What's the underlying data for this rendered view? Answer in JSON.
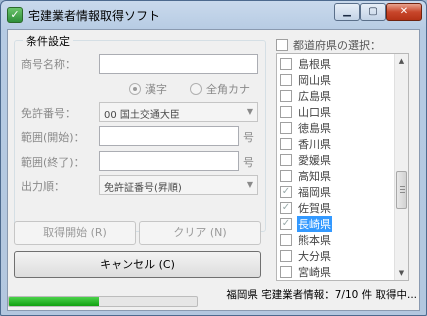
{
  "window": {
    "title": "宅建業者情報取得ソフト",
    "minimize": "▁",
    "maximize": "▢",
    "close": "✕"
  },
  "conditions": {
    "legend": "条件設定",
    "trade_name_label": "商号名称：",
    "trade_name_value": "",
    "radio_kanji": "漢字",
    "radio_kana": "全角カナ",
    "radio_selected": "漢字",
    "license_label": "免許番号：",
    "license_value": "00 国土交通大臣",
    "range_start_label": "範囲(開始)：",
    "range_start_value": "",
    "range_end_label": "範囲(終了)：",
    "range_end_value": "",
    "unit": "号",
    "order_label": "出力順：",
    "order_value": "免許証番号(昇順)"
  },
  "buttons": {
    "start": "取得開始 (R)",
    "clear": "クリア (N)",
    "cancel": "キャンセル (C)"
  },
  "prefectures": {
    "header": "都道府県の選択：",
    "items": [
      {
        "label": "島根県",
        "checked": false
      },
      {
        "label": "岡山県",
        "checked": false
      },
      {
        "label": "広島県",
        "checked": false
      },
      {
        "label": "山口県",
        "checked": false
      },
      {
        "label": "徳島県",
        "checked": false
      },
      {
        "label": "香川県",
        "checked": false
      },
      {
        "label": "愛媛県",
        "checked": false
      },
      {
        "label": "高知県",
        "checked": false
      },
      {
        "label": "福岡県",
        "checked": true
      },
      {
        "label": "佐賀県",
        "checked": true
      },
      {
        "label": "長崎県",
        "checked": true,
        "selected": true
      },
      {
        "label": "熊本県",
        "checked": false
      },
      {
        "label": "大分県",
        "checked": false
      },
      {
        "label": "宮崎県",
        "checked": false
      }
    ]
  },
  "status": {
    "text": "福岡県 宅建業者情報：7/10 件 取得中...",
    "progress": 0.48
  }
}
